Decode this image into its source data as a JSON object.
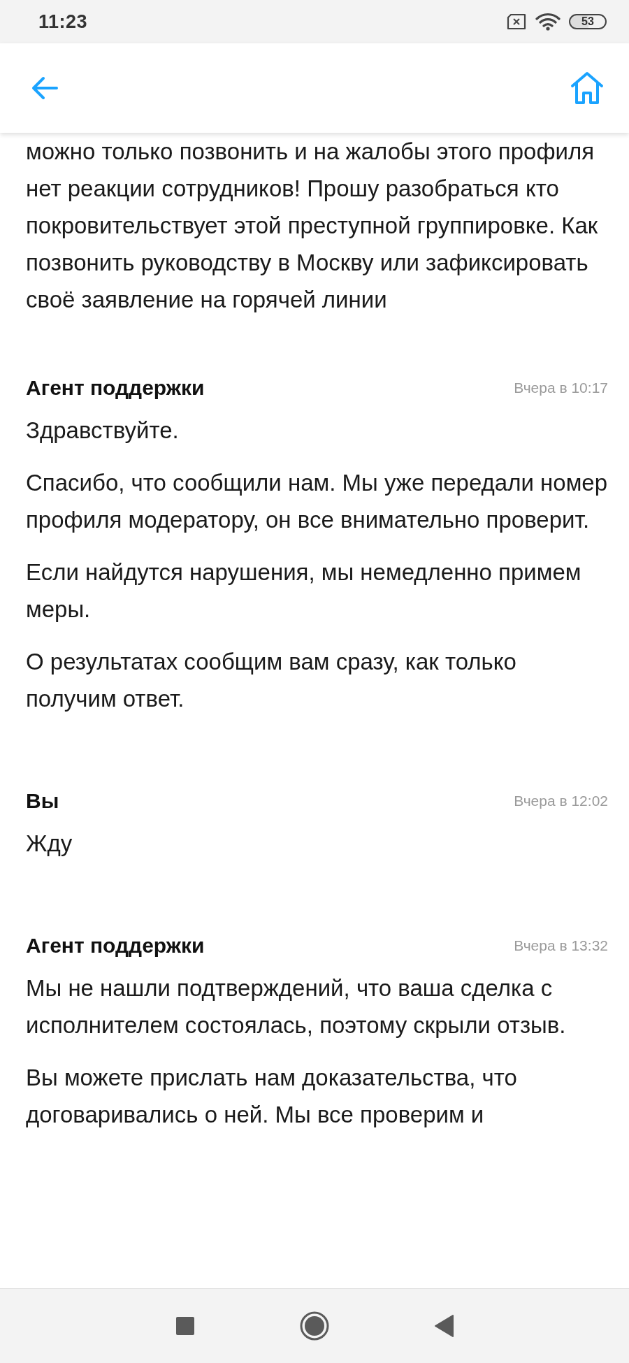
{
  "status_bar": {
    "time": "11:23",
    "battery": "53"
  },
  "messages": [
    {
      "kind": "continued",
      "paragraphs": [
        "можно только позвонить и на жалобы этого профиля нет реакции сотрудников! Прошу разобраться кто покровительствует этой преступной группировке. Как позвонить руководству в Москву или зафиксировать своё заявление на горячей линии"
      ]
    },
    {
      "kind": "full",
      "author": "Агент поддержки",
      "time": "Вчера в 10:17",
      "paragraphs": [
        "Здравствуйте.",
        "Спасибо, что сообщили нам. Мы уже передали номер профиля модератору, он все внимательно проверит.",
        "Если найдутся нарушения, мы немедленно примем меры.",
        "О результатах сообщим вам сразу, как только получим ответ."
      ]
    },
    {
      "kind": "full",
      "author": "Вы",
      "time": "Вчера в 12:02",
      "paragraphs": [
        "Жду"
      ]
    },
    {
      "kind": "full",
      "author": "Агент поддержки",
      "time": "Вчера в 13:32",
      "paragraphs": [
        "Мы не нашли подтверждений, что ваша сделка с исполнителем состоялась, поэтому скрыли отзыв.",
        "Вы можете прислать нам доказательства, что договаривались о ней. Мы все проверим и"
      ]
    }
  ]
}
